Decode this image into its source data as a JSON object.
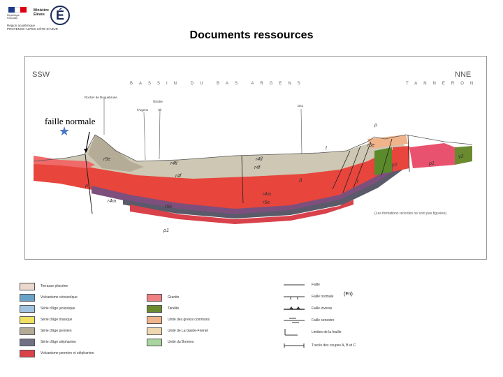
{
  "header": {
    "logo": {
      "republic_text": "République Française",
      "ministry_line1": "Ministère",
      "ministry_line2": "Élèves",
      "letter": "É",
      "org_line1": "Région académique",
      "org_line2": "PROVENCE-ALPES-CÔTE D'AZUR"
    },
    "title": "Documents ressources"
  },
  "cross_section": {
    "left_end": "SSW",
    "right_end": "NNE",
    "basin_label": "BASSIN DU BAS ARGENS",
    "right_region": "TANNERON",
    "top_labels": [
      "Rocher de Roquebrune",
      "l'Argens",
      "Vil",
      "l'Endre",
      "D41"
    ],
    "unit_labels": [
      "r5e",
      "r4f",
      "r4f",
      "r4fl",
      "r4fl",
      "r4m",
      "r4m",
      "r5e",
      "r5e",
      "r5e",
      "ρ",
      "ρ",
      "γ2",
      "γ2",
      "ρ1",
      "ρ1",
      "t",
      "t",
      "Δ"
    ],
    "note": "(Les formations récentes ne sont pas figurées)",
    "annotation": "faille normale",
    "colors": {
      "red": "#e8453c",
      "pink": "#f06a6a",
      "grey": "#b5ac98",
      "olive": "#5b8a2a",
      "purple": "#7d4f7d",
      "darkgrey": "#5a5a6a",
      "light": "#cdc7b3",
      "star": "#4a78c8"
    }
  },
  "legend": {
    "col1": [
      {
        "label": "Terrasse pliocène",
        "color": "#ead8cf"
      },
      {
        "label": "Volcanisme cénozoïque",
        "color": "#6aa3c8"
      },
      {
        "label": "Série d'âge jurassique",
        "color": "#9fc3e0"
      },
      {
        "label": "Série d'âge triasique",
        "color": "#efe061"
      },
      {
        "label": "Série d'âge permien",
        "color": "#b5ac98"
      },
      {
        "label": "Série d'âge stéphanien",
        "color": "#707085"
      },
      {
        "label": "Volcanisme permien et stéphanien",
        "color": "#d9414b"
      }
    ],
    "col2": [
      {
        "label": "Granite",
        "color": "#f08080"
      },
      {
        "label": "Tanéite",
        "color": "#6a8a30"
      },
      {
        "label": "Unité des gneiss communs",
        "color": "#f0b38a"
      },
      {
        "label": "Unité de La Garde-Freinet",
        "color": "#f1d7b0"
      },
      {
        "label": "Unité du Bormes",
        "color": "#a9d6a0"
      }
    ],
    "col3": [
      {
        "label": "Faille",
        "symbol": "fault"
      },
      {
        "label": "Faille normale",
        "symbol": "normal-fault"
      },
      {
        "label": "Faille inverse",
        "symbol": "reverse-fault"
      },
      {
        "label": "Faille senestre",
        "symbol": "sinistral-fault"
      },
      {
        "label": "Limites de la feuille",
        "symbol": "sheet-limit"
      },
      {
        "label": "Tracés des coupes A, B et C",
        "symbol": "section-trace"
      }
    ],
    "fn_label": "(Fn)"
  }
}
